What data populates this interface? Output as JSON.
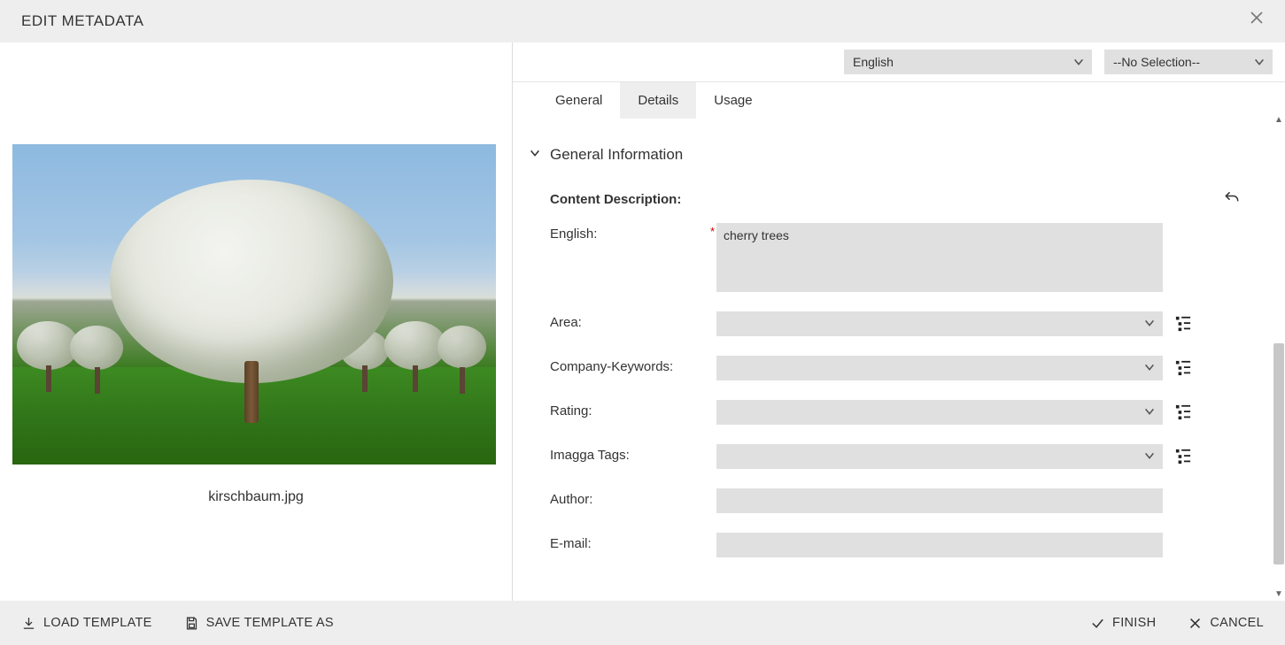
{
  "header": {
    "title": "EDIT METADATA"
  },
  "preview": {
    "filename": "kirschbaum.jpg"
  },
  "topSelects": {
    "language": "English",
    "selection": "--No Selection--"
  },
  "tabs": {
    "general": "General",
    "details": "Details",
    "usage": "Usage",
    "active": "details"
  },
  "section": {
    "title": "General Information"
  },
  "fields": {
    "contentDescriptionLabel": "Content Description:",
    "contentDescLangLabel": "English:",
    "contentDescValue": "cherry trees",
    "areaLabel": "Area:",
    "areaValue": "",
    "companyKeywordsLabel": "Company-Keywords:",
    "companyKeywordsValue": "",
    "ratingLabel": "Rating:",
    "ratingValue": "",
    "imaggaLabel": "Imagga Tags:",
    "imaggaValue": "",
    "authorLabel": "Author:",
    "authorValue": "",
    "emailLabel": "E-mail:",
    "emailValue": ""
  },
  "footer": {
    "loadTemplate": "LOAD TEMPLATE",
    "saveTemplateAs": "SAVE TEMPLATE AS",
    "finish": "FINISH",
    "cancel": "CANCEL"
  }
}
